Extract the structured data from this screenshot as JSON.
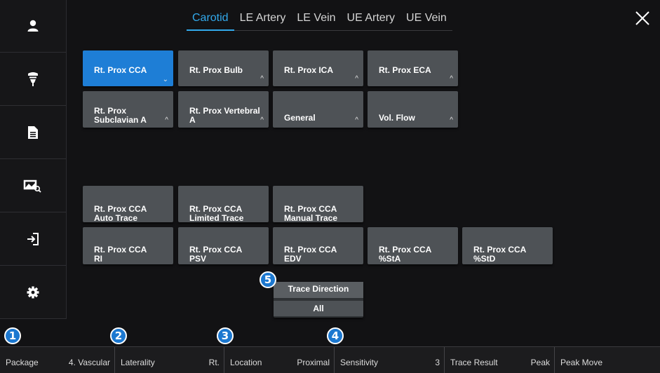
{
  "tabs": [
    {
      "label": "Carotid",
      "active": true
    },
    {
      "label": "LE Artery"
    },
    {
      "label": "LE Vein"
    },
    {
      "label": "UE Artery"
    },
    {
      "label": "UE Vein"
    }
  ],
  "sidebar": {
    "items": [
      {
        "icon": "patient-icon"
      },
      {
        "icon": "probe-icon"
      },
      {
        "icon": "report-icon"
      },
      {
        "icon": "image-review-icon"
      },
      {
        "icon": "exit-icon"
      },
      {
        "icon": "settings-icon"
      }
    ]
  },
  "measurements": {
    "row1": [
      {
        "label": "Rt. Prox CCA",
        "selected": true,
        "caret": "⌄"
      },
      {
        "label": "Rt. Prox Bulb",
        "caret": "^"
      },
      {
        "label": "Rt. Prox ICA",
        "caret": "^"
      },
      {
        "label": "Rt. Prox ECA",
        "caret": "^"
      }
    ],
    "row2": [
      {
        "label": "Rt. Prox\nSubclavian A",
        "caret": "^"
      },
      {
        "label": "Rt. Prox Vertebral\nA",
        "caret": "^"
      },
      {
        "label": "General",
        "caret": "^"
      },
      {
        "label": "Vol. Flow",
        "caret": "^"
      }
    ],
    "trace_row": [
      {
        "label": "Rt. Prox CCA\nAuto Trace"
      },
      {
        "label": "Rt. Prox CCA\nLimited Trace"
      },
      {
        "label": "Rt. Prox CCA\nManual Trace"
      }
    ],
    "result_row": [
      {
        "label": "Rt. Prox CCA\nRI"
      },
      {
        "label": "Rt. Prox CCA\nPSV"
      },
      {
        "label": "Rt. Prox CCA\nEDV"
      },
      {
        "label": "Rt. Prox CCA\n%StA"
      },
      {
        "label": "Rt. Prox CCA\n%StD"
      }
    ]
  },
  "trace_direction": {
    "title": "Trace Direction",
    "value": "All"
  },
  "badges": [
    "1",
    "2",
    "3",
    "4",
    "5"
  ],
  "bottom_bar": [
    {
      "label": "Package",
      "value": "4. Vascular"
    },
    {
      "label": "Laterality",
      "value": "Rt."
    },
    {
      "label": "Location",
      "value": "Proximal"
    },
    {
      "label": "Sensitivity",
      "value": "3"
    },
    {
      "label": "Trace Result",
      "value": "Peak"
    },
    {
      "label": "Peak Move",
      "value": ""
    }
  ],
  "colors": {
    "accent": "#32a9ec",
    "selected": "#1e7ed6",
    "badge": "#1c78d0",
    "button": "#4e5256"
  }
}
